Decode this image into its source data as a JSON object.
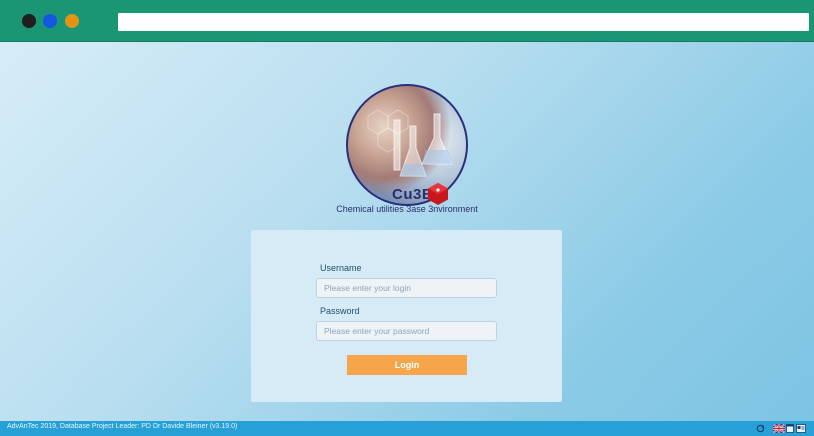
{
  "window": {
    "address_value": ""
  },
  "logo": {
    "text": "Cu3E",
    "tagline": "Chemical utilities 3ase 3nvironment"
  },
  "login": {
    "username_label": "Username",
    "username_placeholder": "Please enter your login",
    "password_label": "Password",
    "password_placeholder": "Please enter your password",
    "button_label": "Login"
  },
  "footer": {
    "text": "AdvAnTec 2019, Database Project Leader: PD Dr Davide Bleiner (v3.19.0)",
    "icons": [
      "refresh-icon",
      "uk-flag-icon",
      "window-icon",
      "id-card-icon"
    ]
  },
  "colors": {
    "topbar": "#1a9674",
    "button": "#f7a54a",
    "footer": "#27a0d6",
    "card": "#d6ebf6",
    "dot_black": "#1f1f1f",
    "dot_blue": "#1457e0",
    "dot_orange": "#e39416"
  }
}
